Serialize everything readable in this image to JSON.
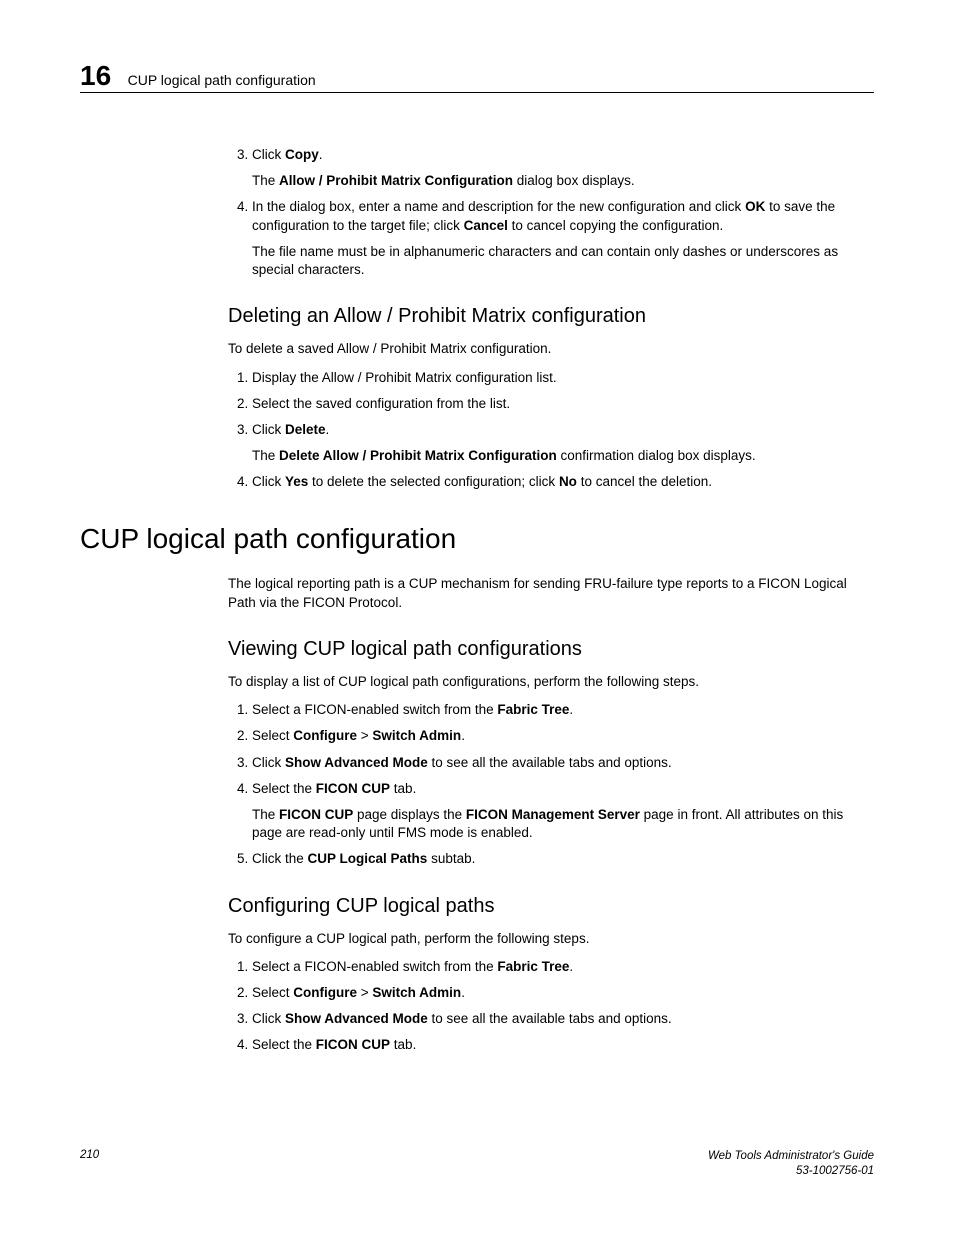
{
  "header": {
    "chapter": "16",
    "title": "CUP logical path configuration"
  },
  "top_steps": {
    "s3_click": "Click ",
    "s3_bold": "Copy",
    "s3_end": ".",
    "s3_sub_a": "The ",
    "s3_sub_bold": "Allow / Prohibit Matrix Configuration",
    "s3_sub_b": " dialog box displays.",
    "s4_a": "In the dialog box, enter a name and description for the new configuration and click ",
    "s4_b_bold": "OK",
    "s4_c": " to save the configuration to the target file; click ",
    "s4_d_bold": "Cancel",
    "s4_e": " to cancel copying the configuration.",
    "s4_sub": "The file name must be in alphanumeric characters and can contain only dashes or underscores as special characters."
  },
  "deleting": {
    "heading": "Deleting an Allow / Prohibit Matrix configuration",
    "intro": "To delete a saved Allow / Prohibit Matrix configuration.",
    "s1": "Display the Allow / Prohibit Matrix configuration list.",
    "s2": "Select the saved configuration from the list.",
    "s3_a": "Click ",
    "s3_b_bold": "Delete",
    "s3_c": ".",
    "s3_sub_a": "The ",
    "s3_sub_bold": "Delete Allow / Prohibit Matrix Configuration",
    "s3_sub_b": " confirmation dialog box displays.",
    "s4_a": "Click ",
    "s4_b_bold": "Yes",
    "s4_c": " to delete the selected configuration; click ",
    "s4_d_bold": "No",
    "s4_e": " to cancel the deletion."
  },
  "cup": {
    "heading": "CUP logical path configuration",
    "intro": "The logical reporting path is a CUP mechanism for sending FRU-failure type reports to a FICON Logical Path via the FICON Protocol."
  },
  "viewing": {
    "heading": "Viewing CUP logical path configurations",
    "intro": "To display a list of CUP logical path configurations, perform the following steps.",
    "s1_a": "Select a FICON-enabled switch from the ",
    "s1_b_bold": "Fabric Tree",
    "s1_c": ".",
    "s2_a": "Select ",
    "s2_b_bold": "Configure",
    "s2_c": " > ",
    "s2_d_bold": "Switch Admin",
    "s2_e": ".",
    "s3_a": "Click ",
    "s3_b_bold": "Show Advanced Mode",
    "s3_c": " to see all the available tabs and options.",
    "s4_a": "Select the ",
    "s4_b_bold": "FICON CUP",
    "s4_c": " tab.",
    "s4_sub_a": "The ",
    "s4_sub_b_bold": "FICON CUP",
    "s4_sub_c": " page displays the ",
    "s4_sub_d_bold": "FICON Management Server",
    "s4_sub_e": " page in front. All attributes on this page are read-only until FMS mode is enabled.",
    "s5_a": "Click the ",
    "s5_b_bold": "CUP Logical Paths",
    "s5_c": " subtab."
  },
  "configuring": {
    "heading": "Configuring CUP logical paths",
    "intro": "To configure a CUP logical path, perform the following steps.",
    "s1_a": "Select a FICON-enabled switch from the ",
    "s1_b_bold": "Fabric Tree",
    "s1_c": ".",
    "s2_a": "Select ",
    "s2_b_bold": "Configure",
    "s2_c": " > ",
    "s2_d_bold": "Switch Admin",
    "s2_e": ".",
    "s3_a": "Click ",
    "s3_b_bold": "Show Advanced Mode",
    "s3_c": " to see all the available tabs and options.",
    "s4_a": "Select the ",
    "s4_b_bold": "FICON CUP",
    "s4_c": " tab."
  },
  "footer": {
    "page": "210",
    "guide": "Web Tools Administrator's Guide",
    "docnum": "53-1002756-01"
  }
}
